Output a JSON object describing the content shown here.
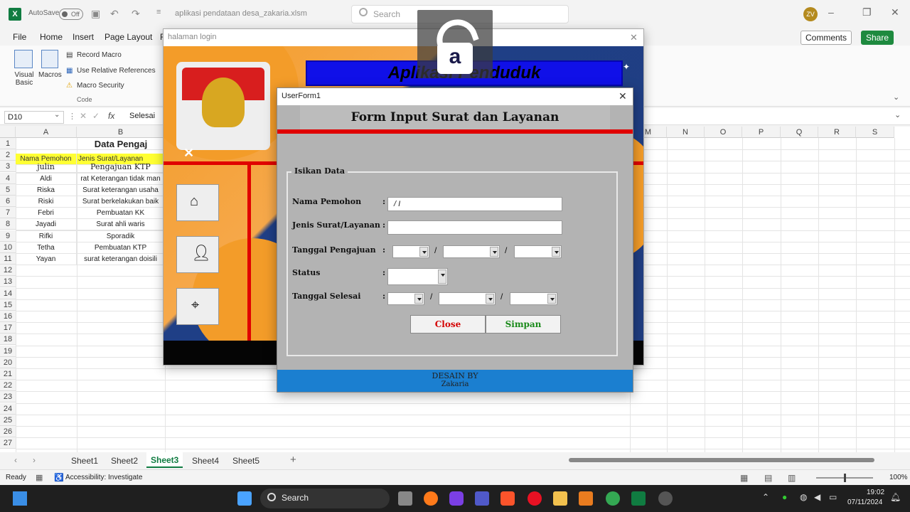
{
  "titlebar": {
    "autosave_label": "AutoSave",
    "toggle_state": "Off",
    "filename": "aplikasi pendataan desa_zakaria.xlsm",
    "search_placeholder": "Search",
    "avatar_initials": "ZV"
  },
  "ribbon_tabs": [
    "File",
    "Home",
    "Insert",
    "Page Layout",
    "F"
  ],
  "ribbon_buttons": {
    "comments": "Comments",
    "share": "Share"
  },
  "ribbon_code": {
    "visual_basic": "Visual Basic",
    "macros": "Macros",
    "record_macro": "Record Macro",
    "relative_refs": "Use Relative References",
    "macro_security": "Macro Security",
    "group_label": "Code"
  },
  "formula_bar": {
    "name_box": "D10",
    "fx": "fx",
    "value": "Selesai"
  },
  "columns": [
    "A",
    "B",
    "M",
    "N",
    "O",
    "P",
    "Q",
    "R",
    "S"
  ],
  "sheet": {
    "title": "Data Pengaj",
    "headers": [
      "Nama Pemohon",
      "Jenis Surat/Layanan"
    ],
    "rows": [
      [
        "julin",
        "Pengajuan KTP"
      ],
      [
        "Aldi",
        "rat Keterangan tidak man"
      ],
      [
        "Riska",
        "Surat keterangan usaha"
      ],
      [
        "Riski",
        "Surat berkelakukan baik"
      ],
      [
        "Febri",
        "Pembuatan KK"
      ],
      [
        "Jayadi",
        "Surat ahli waris"
      ],
      [
        "Rifki",
        "Sporadik"
      ],
      [
        "Tetha",
        "Pembuatan KTP"
      ],
      [
        "Yayan",
        "surat keterangan doisili"
      ]
    ],
    "row_numbers": [
      "1",
      "2",
      "3",
      "4",
      "5",
      "6",
      "7",
      "8",
      "9",
      "10",
      "11",
      "12",
      "13",
      "14",
      "15",
      "16",
      "17",
      "18",
      "19",
      "20",
      "21",
      "22",
      "23",
      "24",
      "25",
      "26",
      "27"
    ]
  },
  "sheet_tabs": [
    "Sheet1",
    "Sheet2",
    "Sheet3",
    "Sheet4",
    "Sheet5"
  ],
  "active_sheet": "Sheet3",
  "status": {
    "ready": "Ready",
    "accessibility": "Accessibility: Investigate",
    "zoom": "100%"
  },
  "login_window": {
    "title": "halaman login",
    "banner": "Aplikasi      Penduduk"
  },
  "userform": {
    "title": "UserForm1",
    "heading": "Form Input Surat dan Layanan",
    "frame_label": "Isikan Data",
    "fields": {
      "nama_pemohon": "Nama Pemohon",
      "jenis_surat": "Jenis Surat/Layanan",
      "tanggal_pengajuan": "Tanggal Pengajuan",
      "status": "Status",
      "tanggal_selesai": "Tanggal Selesai"
    },
    "nama_value": "/  I",
    "close_label": "Close",
    "simpan_label": "Simpan",
    "footer_line1": "DESAIN BY",
    "footer_line2": "Zakaria"
  },
  "taskbar": {
    "search_label": "Search",
    "time": "19:02",
    "date": "07/11/2024"
  },
  "colors": {
    "excel_green": "#107c41",
    "red_accent": "#e00000",
    "footer_blue": "#1b7fd0",
    "close_red": "#d40000",
    "simpan_green": "#1a8a1a"
  }
}
